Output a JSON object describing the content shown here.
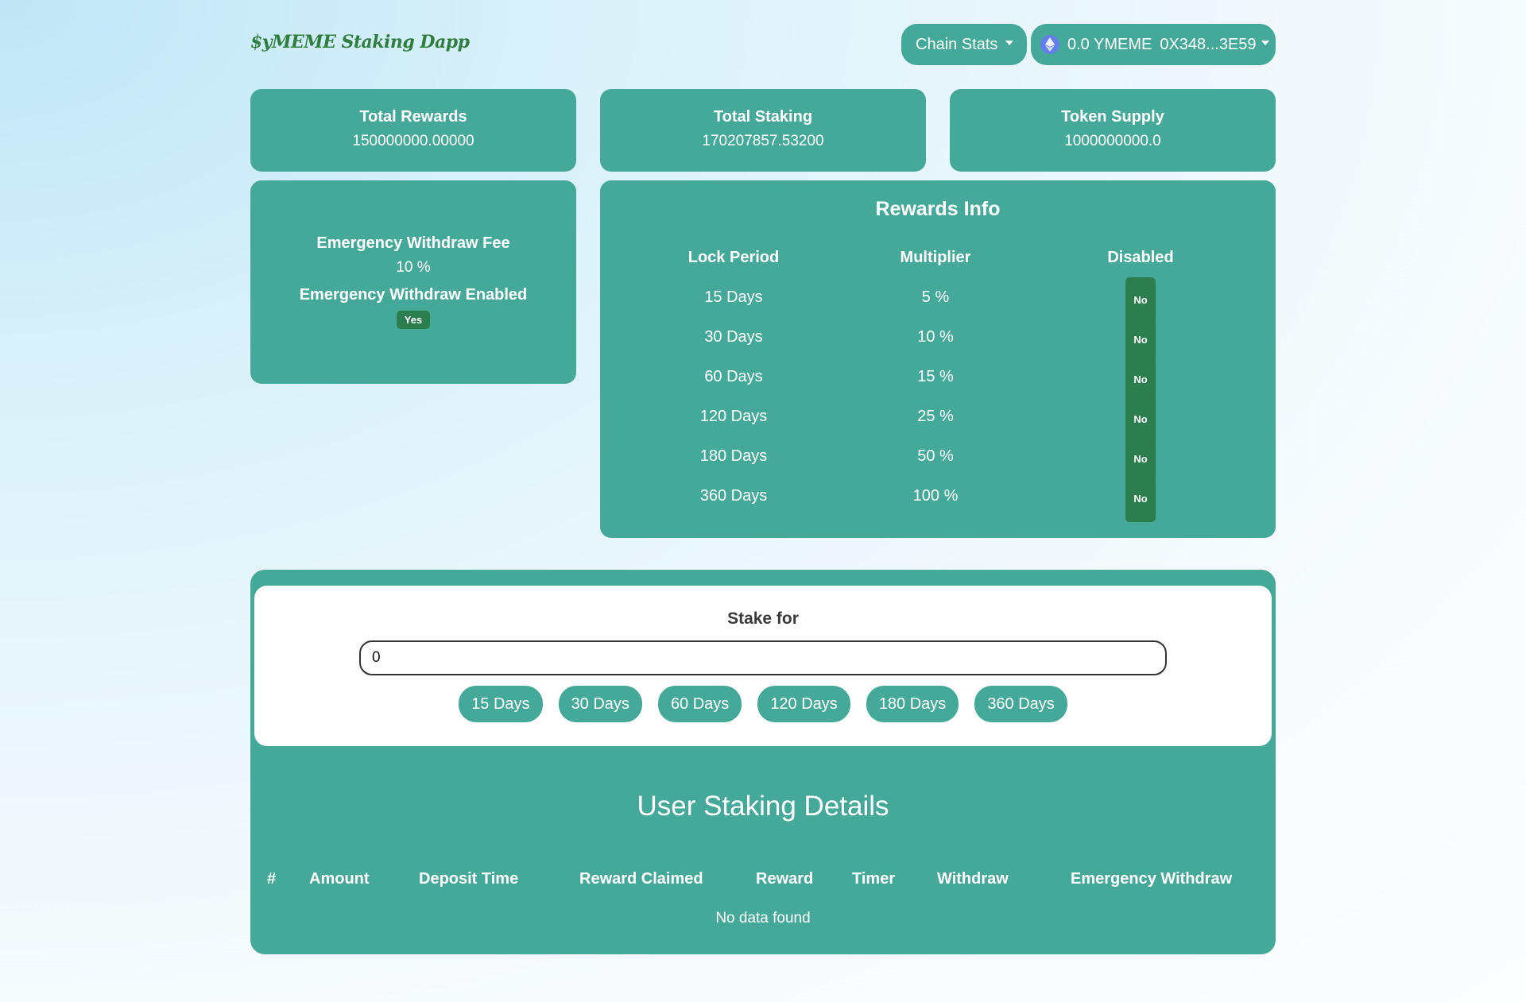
{
  "header": {
    "logo": "$yMEME Staking Dapp",
    "chain_stats_label": "Chain Stats",
    "wallet_balance": "0.0 YMEME",
    "wallet_address": "0X348...3E59"
  },
  "stats": [
    {
      "label": "Total Rewards",
      "value": "150000000.00000"
    },
    {
      "label": "Total Staking",
      "value": "170207857.53200"
    },
    {
      "label": "Token Supply",
      "value": "1000000000.0"
    }
  ],
  "emergency": {
    "fee_label": "Emergency Withdraw Fee",
    "fee_value": "10 %",
    "enabled_label": "Emergency Withdraw Enabled",
    "enabled_value": "Yes"
  },
  "rewards_info": {
    "title": "Rewards Info",
    "headers": {
      "lock_period": "Lock Period",
      "multiplier": "Multiplier",
      "disabled": "Disabled"
    },
    "rows": [
      {
        "lock_period": "15 Days",
        "multiplier": "5 %",
        "disabled": "No"
      },
      {
        "lock_period": "30 Days",
        "multiplier": "10 %",
        "disabled": "No"
      },
      {
        "lock_period": "60 Days",
        "multiplier": "15 %",
        "disabled": "No"
      },
      {
        "lock_period": "120 Days",
        "multiplier": "25 %",
        "disabled": "No"
      },
      {
        "lock_period": "180 Days",
        "multiplier": "50 %",
        "disabled": "No"
      },
      {
        "lock_period": "360 Days",
        "multiplier": "100 %",
        "disabled": "No"
      }
    ]
  },
  "stake": {
    "label": "Stake for",
    "input_value": "0",
    "buttons": [
      "15 Days",
      "30 Days",
      "60 Days",
      "120 Days",
      "180 Days",
      "360 Days"
    ]
  },
  "user_details": {
    "title": "User Staking Details",
    "columns": [
      "#",
      "Amount",
      "Deposit Time",
      "Reward Claimed",
      "Reward",
      "Timer",
      "Withdraw",
      "Emergency Withdraw"
    ],
    "empty_message": "No data found"
  },
  "colors": {
    "teal": "#45a99a",
    "badge_green": "#2c7e4e",
    "logo_green": "#2f7d3f",
    "eth_blue": "#627eea"
  },
  "icons": {
    "wallet_chain": "ethereum-icon",
    "dropdown": "caret-down-icon"
  }
}
